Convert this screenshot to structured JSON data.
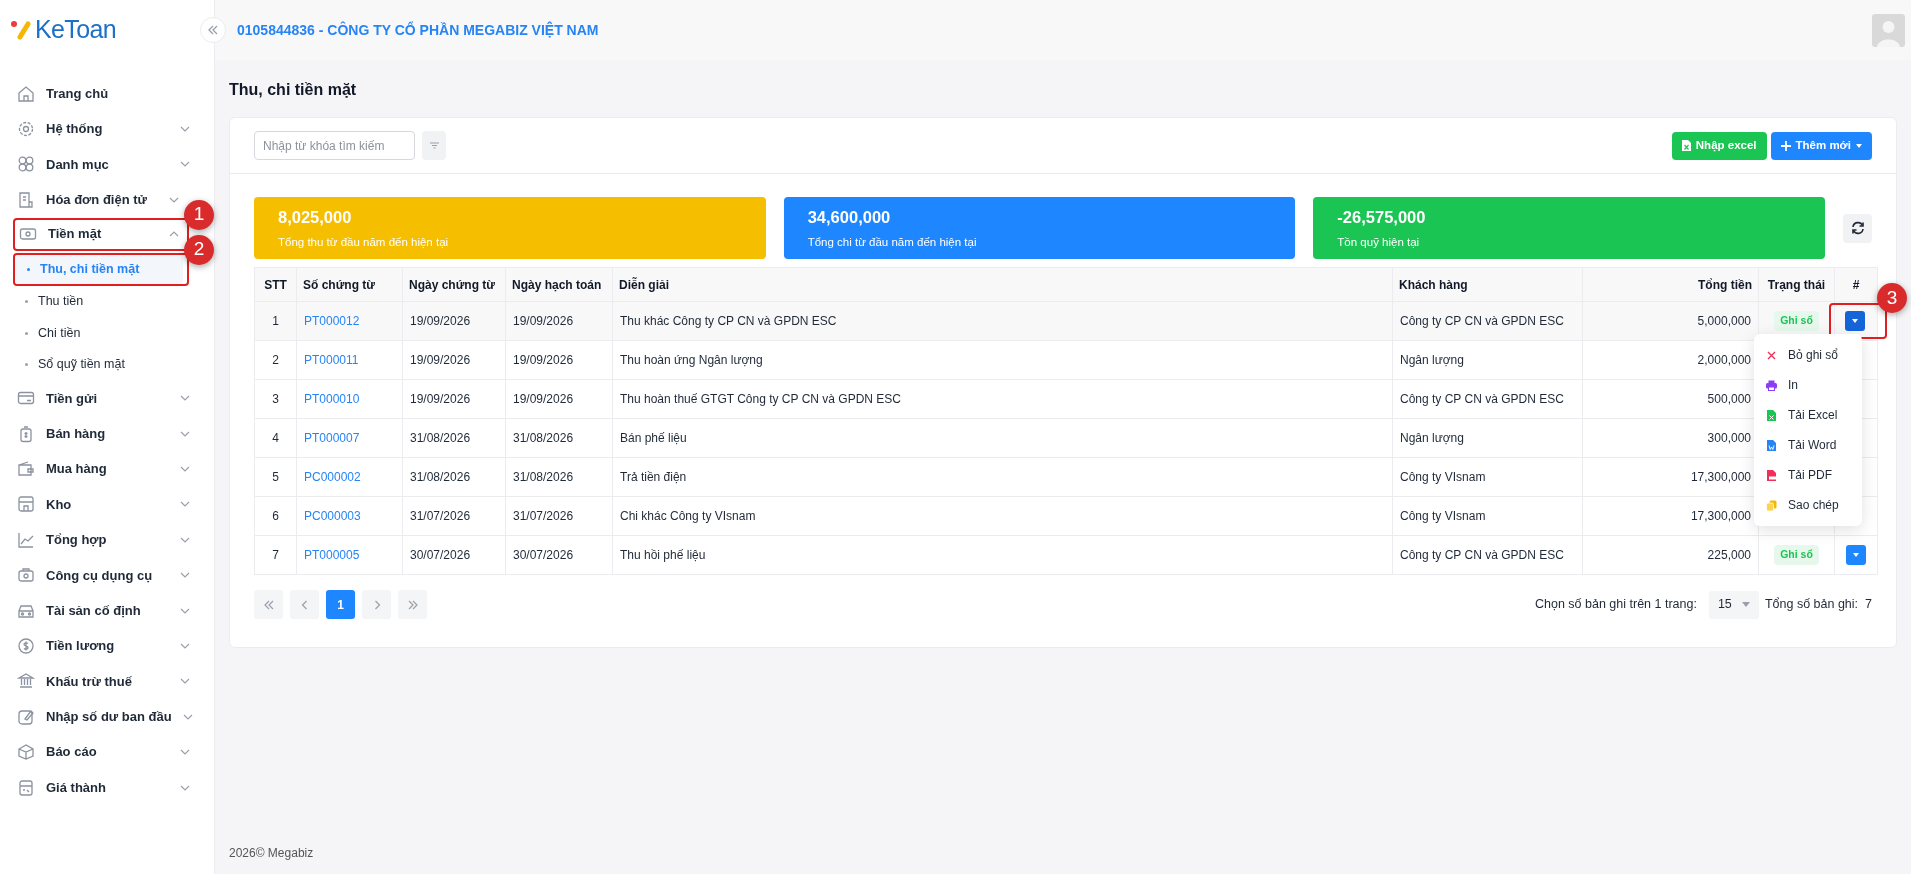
{
  "logo": {
    "text": "KeToan"
  },
  "header": {
    "company": "0105844836 - CÔNG TY CỔ PHẦN MEGABIZ VIỆT NAM"
  },
  "sidebar": {
    "items": [
      {
        "label": "Trang chủ"
      },
      {
        "label": "Hệ thống",
        "expanded": false
      },
      {
        "label": "Danh mục",
        "expanded": false
      },
      {
        "label": "Hóa đơn điện tử",
        "expanded": false
      },
      {
        "label": "Tiền mặt",
        "expanded": true,
        "annotation": "1",
        "children": [
          {
            "label": "Thu, chi tiền mặt",
            "selected": true,
            "annotation": "2"
          },
          {
            "label": "Thu tiền",
            "selected": false
          },
          {
            "label": "Chi tiền",
            "selected": false
          },
          {
            "label": "Sổ quỹ tiền mặt",
            "selected": false
          }
        ]
      },
      {
        "label": "Tiền gửi",
        "expanded": false
      },
      {
        "label": "Bán hàng",
        "expanded": false
      },
      {
        "label": "Mua hàng",
        "expanded": false
      },
      {
        "label": "Kho",
        "expanded": false
      },
      {
        "label": "Tổng hợp",
        "expanded": false
      },
      {
        "label": "Công cụ dụng cụ",
        "expanded": false
      },
      {
        "label": "Tài sản cố định",
        "expanded": false
      },
      {
        "label": "Tiền lương",
        "expanded": false
      },
      {
        "label": "Khấu trừ thuế",
        "expanded": false
      },
      {
        "label": "Nhập số dư ban đầu",
        "expanded": false
      },
      {
        "label": "Báo cáo",
        "expanded": false
      },
      {
        "label": "Giá thành",
        "expanded": false
      }
    ]
  },
  "page_title": "Thu, chi tiền mặt",
  "toolbar": {
    "search": {
      "placeholder": "Nhập từ khóa tìm kiếm"
    },
    "buttons": [
      {
        "label": "Nhập excel",
        "kind": "import"
      },
      {
        "label": "Thêm mới",
        "kind": "add"
      }
    ]
  },
  "summary": [
    {
      "value": "8,025,000",
      "label": "Tổng thu từ đầu năm đến hiện tại",
      "color": "#f5bf00"
    },
    {
      "value": "34,600,000",
      "label": "Tổng chi từ đầu năm đến hiện tại",
      "color": "#1e86ff"
    },
    {
      "value": "-26,575,000",
      "label": "Tồn quỹ hiện tại",
      "color": "#1bc553"
    }
  ],
  "table": {
    "columns": [
      "STT",
      "Số chứng từ",
      "Ngày chứng từ",
      "Ngày hạch toán",
      "Diễn giải",
      "Khách hàng",
      "Tổng tiền",
      "Trạng thái",
      "#"
    ],
    "rows": [
      {
        "cells": [
          "1",
          "PT000012",
          "19/09/2026",
          "19/09/2026",
          "Thu khác Công ty CP CN và GPDN ESC",
          "Công ty CP CN và GPDN ESC",
          "5,000,000"
        ],
        "status": "Ghi sổ",
        "menu_open": true,
        "annotation": "3"
      },
      {
        "cells": [
          "2",
          "PT000011",
          "19/09/2026",
          "19/09/2026",
          "Thu hoàn ứng Ngân lượng",
          "Ngân lượng",
          "2,000,000"
        ]
      },
      {
        "cells": [
          "3",
          "PT000010",
          "19/09/2026",
          "19/09/2026",
          "Thu hoàn thuế GTGT Công ty CP CN và GPDN ESC",
          "Công ty CP CN và GPDN ESC",
          "500,000"
        ]
      },
      {
        "cells": [
          "4",
          "PT000007",
          "31/08/2026",
          "31/08/2026",
          "Bán phế liệu",
          "Ngân lượng",
          "300,000"
        ]
      },
      {
        "cells": [
          "5",
          "PC000002",
          "31/08/2026",
          "31/08/2026",
          "Trả tiền điện",
          "Công ty VIsnam",
          "17,300,000"
        ]
      },
      {
        "cells": [
          "6",
          "PC000003",
          "31/07/2026",
          "31/07/2026",
          "Chi khác Công ty VIsnam",
          "Công ty VIsnam",
          "17,300,000"
        ]
      },
      {
        "cells": [
          "7",
          "PT000005",
          "30/07/2026",
          "30/07/2026",
          "Thu hồi phế liệu",
          "Công ty CP CN và GPDN ESC",
          "225,000"
        ],
        "status": "Ghi sổ",
        "menu_open": false
      }
    ]
  },
  "row_menu": [
    {
      "label": "Bỏ ghi sổ",
      "kind": "unpost"
    },
    {
      "label": "In",
      "kind": "print"
    },
    {
      "label": "Tải Excel",
      "kind": "excel"
    },
    {
      "label": "Tải Word",
      "kind": "word"
    },
    {
      "label": "Tải PDF",
      "kind": "pdf"
    },
    {
      "label": "Sao chép",
      "kind": "copy"
    }
  ],
  "pagination": {
    "pages": [
      {
        "label": "1",
        "selected": true
      }
    ],
    "page_size_label": "Chọn số bản ghi trên 1 trang:",
    "page_size": "15",
    "total_label": "Tổng số bản ghi:",
    "total": "7"
  },
  "footer": "2026© Megabiz"
}
